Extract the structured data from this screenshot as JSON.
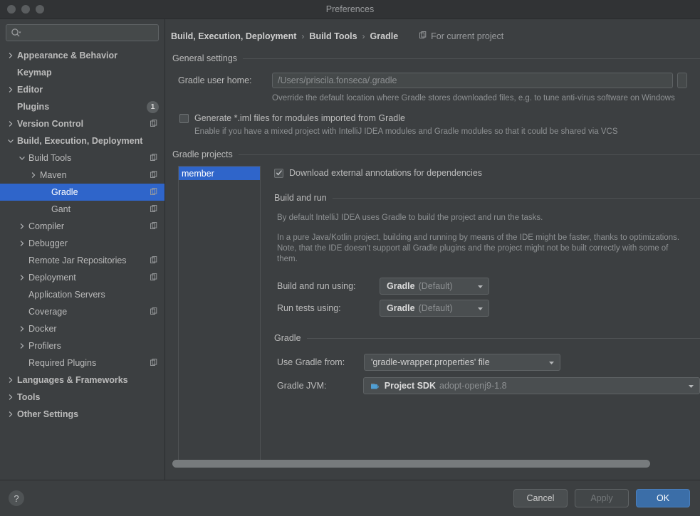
{
  "window": {
    "title": "Preferences",
    "traffic_lights": [
      "close-button",
      "minimize-button",
      "zoom-button"
    ]
  },
  "sidebar": {
    "search": {
      "value": "",
      "placeholder": ""
    },
    "items": [
      {
        "label": "Appearance & Behavior",
        "arrow": "right",
        "indent": 0,
        "bold": true,
        "copy": false,
        "badge": null,
        "selected": false
      },
      {
        "label": "Keymap",
        "arrow": "none",
        "indent": 0,
        "bold": true,
        "copy": false,
        "badge": null,
        "selected": false
      },
      {
        "label": "Editor",
        "arrow": "right",
        "indent": 0,
        "bold": true,
        "copy": false,
        "badge": null,
        "selected": false
      },
      {
        "label": "Plugins",
        "arrow": "none",
        "indent": 0,
        "bold": true,
        "copy": false,
        "badge": "1",
        "selected": false
      },
      {
        "label": "Version Control",
        "arrow": "right",
        "indent": 0,
        "bold": true,
        "copy": true,
        "badge": null,
        "selected": false
      },
      {
        "label": "Build, Execution, Deployment",
        "arrow": "down",
        "indent": 0,
        "bold": true,
        "copy": false,
        "badge": null,
        "selected": false
      },
      {
        "label": "Build Tools",
        "arrow": "down",
        "indent": 1,
        "bold": false,
        "copy": true,
        "badge": null,
        "selected": false
      },
      {
        "label": "Maven",
        "arrow": "right",
        "indent": 2,
        "bold": false,
        "copy": true,
        "badge": null,
        "selected": false
      },
      {
        "label": "Gradle",
        "arrow": "none",
        "indent": 3,
        "bold": false,
        "copy": true,
        "badge": null,
        "selected": true
      },
      {
        "label": "Gant",
        "arrow": "none",
        "indent": 3,
        "bold": false,
        "copy": true,
        "badge": null,
        "selected": false
      },
      {
        "label": "Compiler",
        "arrow": "right",
        "indent": 1,
        "bold": false,
        "copy": true,
        "badge": null,
        "selected": false
      },
      {
        "label": "Debugger",
        "arrow": "right",
        "indent": 1,
        "bold": false,
        "copy": false,
        "badge": null,
        "selected": false
      },
      {
        "label": "Remote Jar Repositories",
        "arrow": "none",
        "indent": 1,
        "bold": false,
        "copy": true,
        "badge": null,
        "selected": false
      },
      {
        "label": "Deployment",
        "arrow": "right",
        "indent": 1,
        "bold": false,
        "copy": true,
        "badge": null,
        "selected": false
      },
      {
        "label": "Application Servers",
        "arrow": "none",
        "indent": 1,
        "bold": false,
        "copy": false,
        "badge": null,
        "selected": false
      },
      {
        "label": "Coverage",
        "arrow": "none",
        "indent": 1,
        "bold": false,
        "copy": true,
        "badge": null,
        "selected": false
      },
      {
        "label": "Docker",
        "arrow": "right",
        "indent": 1,
        "bold": false,
        "copy": false,
        "badge": null,
        "selected": false
      },
      {
        "label": "Profilers",
        "arrow": "right",
        "indent": 1,
        "bold": false,
        "copy": false,
        "badge": null,
        "selected": false
      },
      {
        "label": "Required Plugins",
        "arrow": "none",
        "indent": 1,
        "bold": false,
        "copy": true,
        "badge": null,
        "selected": false
      },
      {
        "label": "Languages & Frameworks",
        "arrow": "right",
        "indent": 0,
        "bold": true,
        "copy": false,
        "badge": null,
        "selected": false
      },
      {
        "label": "Tools",
        "arrow": "right",
        "indent": 0,
        "bold": true,
        "copy": false,
        "badge": null,
        "selected": false
      },
      {
        "label": "Other Settings",
        "arrow": "right",
        "indent": 0,
        "bold": true,
        "copy": false,
        "badge": null,
        "selected": false
      }
    ]
  },
  "breadcrumb": {
    "crumb1": "Build, Execution, Deployment",
    "crumb2": "Build Tools",
    "crumb3": "Gradle",
    "separator": "›",
    "for_current_project": "For current project"
  },
  "general_settings": {
    "title": "General settings",
    "gradle_user_home_label": "Gradle user home:",
    "gradle_user_home_value": "",
    "gradle_user_home_placeholder": "/Users/priscila.fonseca/.gradle",
    "gradle_user_home_hint": "Override the default location where Gradle stores downloaded files, e.g. to tune anti-virus software on Windows",
    "generate_iml_label": "Generate *.iml files for modules imported from Gradle",
    "generate_iml_checked": false,
    "generate_iml_hint": "Enable if you have a mixed project with IntelliJ IDEA modules and Gradle modules so that it could be shared via VCS"
  },
  "gradle_projects": {
    "title": "Gradle projects",
    "list": [
      {
        "label": "member",
        "selected": true
      }
    ],
    "download_annotations_label": "Download external annotations for dependencies",
    "download_annotations_checked": true
  },
  "build_and_run": {
    "title": "Build and run",
    "paragraph1": "By default IntelliJ IDEA uses Gradle to build the project and run the tasks.",
    "paragraph2": "In a pure Java/Kotlin project, building and running by means of the IDE might be faster, thanks to optimizations. Note, that the IDE doesn't support all Gradle plugins and the project might not be built correctly with some of them.",
    "build_and_run_using_label": "Build and run using:",
    "build_and_run_using_value": "Gradle",
    "build_and_run_using_suffix": "(Default)",
    "run_tests_using_label": "Run tests using:",
    "run_tests_using_value": "Gradle",
    "run_tests_using_suffix": "(Default)"
  },
  "gradle_section": {
    "title": "Gradle",
    "use_gradle_from_label": "Use Gradle from:",
    "use_gradle_from_value": "'gradle-wrapper.properties' file",
    "gradle_jvm_label": "Gradle JVM:",
    "gradle_jvm_value": "Project SDK",
    "gradle_jvm_suffix": "adopt-openj9-1.8"
  },
  "footer": {
    "help_label": "?",
    "cancel_label": "Cancel",
    "apply_label": "Apply",
    "apply_enabled": false,
    "ok_label": "OK"
  },
  "colors": {
    "accent_selection": "#2f65ca",
    "primary_button": "#3b6ea8",
    "window_bg": "#3c3f41",
    "titlebar_bg": "#313335",
    "field_bg": "#45494a",
    "text": "#bbbbbb",
    "text_dim": "#8e9193",
    "sdk_icon": "#4f9fd4"
  }
}
